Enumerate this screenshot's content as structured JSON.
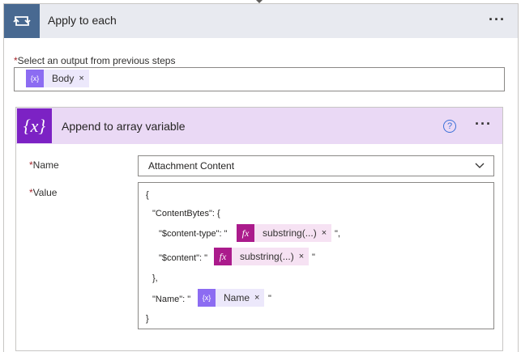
{
  "loop": {
    "title": "Apply to each",
    "more_label": "···",
    "icon": "loop-icon"
  },
  "select_output": {
    "required_mark": "*",
    "label": "Select an output from previous steps",
    "token": {
      "label": "Body",
      "remove": "×",
      "icon": "{x}"
    }
  },
  "action": {
    "title": "Append to array variable",
    "icon_text": "{x}",
    "help_label": "?",
    "more_label": "···",
    "name_field": {
      "required_mark": "*",
      "label": "Name",
      "value": "Attachment Content"
    },
    "value_field": {
      "required_mark": "*",
      "label": "Value",
      "lines": {
        "open_brace": "{",
        "content_bytes": "\"ContentBytes\": {",
        "content_type_key": "\"$content-type\": \"",
        "content_type_end": "\",",
        "content_key": "\"$content\": \"",
        "content_end": "\"",
        "close_inner": "},",
        "name_key": "\"Name\": \"",
        "name_end": "\"",
        "close_brace": "}"
      },
      "tokens": {
        "fx1": {
          "icon": "fx",
          "label": "substring(...)",
          "remove": "×"
        },
        "fx2": {
          "icon": "fx",
          "label": "substring(...)",
          "remove": "×"
        },
        "name": {
          "icon": "{x}",
          "label": "Name",
          "remove": "×"
        }
      }
    }
  },
  "colors": {
    "loop_header_bg": "#e8eaf0",
    "loop_icon_bg": "#486991",
    "action_header_bg": "#ead9f5",
    "action_icon_bg": "#7c22c4",
    "fx_token_icon": "#ab1b8c",
    "var_token_icon": "#8c6cf2",
    "required": "#a4262c"
  }
}
